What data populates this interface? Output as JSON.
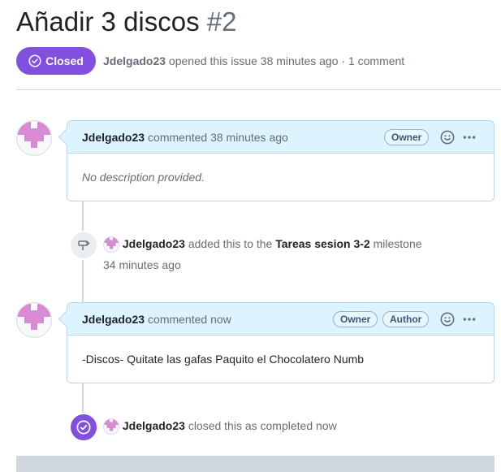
{
  "issue": {
    "title": "Añadir 3 discos",
    "number": "#2",
    "state": "Closed",
    "author": "Jdelgado23",
    "meta_text": "opened this issue 38 minutes ago · 1 comment"
  },
  "timeline": {
    "comment1": {
      "author": "Jdelgado23",
      "time": "commented 38 minutes ago",
      "owner_label": "Owner",
      "body": "No description provided."
    },
    "milestone_event": {
      "author": "Jdelgado23",
      "text_before": "added this to the",
      "milestone": "Tareas sesion 3-2",
      "text_after": "milestone",
      "time": "34 minutes ago"
    },
    "comment2": {
      "author": "Jdelgado23",
      "time": "commented now",
      "owner_label": "Owner",
      "author_label": "Author",
      "body": "-Discos- Quitate las gafas Paquito el Chocolatero Numb"
    },
    "closed_event": {
      "author": "Jdelgado23",
      "text": "closed this as completed now"
    }
  },
  "colors": {
    "closed_purple": "#8250df",
    "header_blue": "#ddf4ff",
    "avatar_pink": "#d98ad6"
  },
  "icons": {
    "state": "check-circle-icon",
    "milestone": "milestone-icon",
    "emoji": "smiley-icon",
    "more": "kebab-horizontal-icon"
  }
}
